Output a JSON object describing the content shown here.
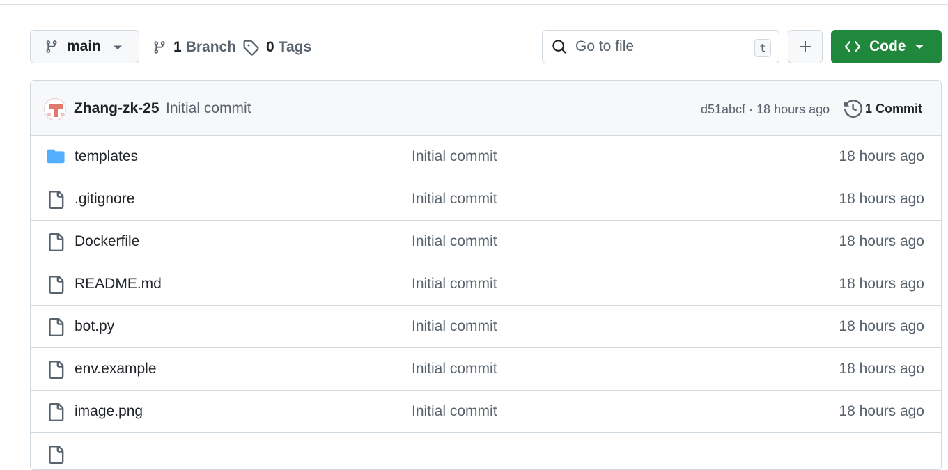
{
  "branch": {
    "name": "main"
  },
  "branches_link": {
    "count": "1",
    "label": "Branch"
  },
  "tags_link": {
    "count": "0",
    "label": "Tags"
  },
  "search": {
    "placeholder": "Go to file",
    "shortcut": "t"
  },
  "code_button": {
    "label": "Code",
    "color": "#1f883d"
  },
  "latest_commit": {
    "author": "Zhang-zk-25",
    "message": "Initial commit",
    "hash_time": "d51abcf · 18 hours ago",
    "commits_label": "1 Commit"
  },
  "files": [
    {
      "name": "templates",
      "type": "folder",
      "message": "Initial commit",
      "age": "18 hours ago"
    },
    {
      "name": ".gitignore",
      "type": "file",
      "message": "Initial commit",
      "age": "18 hours ago"
    },
    {
      "name": "Dockerfile",
      "type": "file",
      "message": "Initial commit",
      "age": "18 hours ago"
    },
    {
      "name": "README.md",
      "type": "file",
      "message": "Initial commit",
      "age": "18 hours ago"
    },
    {
      "name": "bot.py",
      "type": "file",
      "message": "Initial commit",
      "age": "18 hours ago"
    },
    {
      "name": "env.example",
      "type": "file",
      "message": "Initial commit",
      "age": "18 hours ago"
    },
    {
      "name": "image.png",
      "type": "file",
      "message": "Initial commit",
      "age": "18 hours ago"
    }
  ],
  "colors": {
    "folder": "#54aeff",
    "accent_green": "#1f883d",
    "muted_text": "#59636e"
  }
}
